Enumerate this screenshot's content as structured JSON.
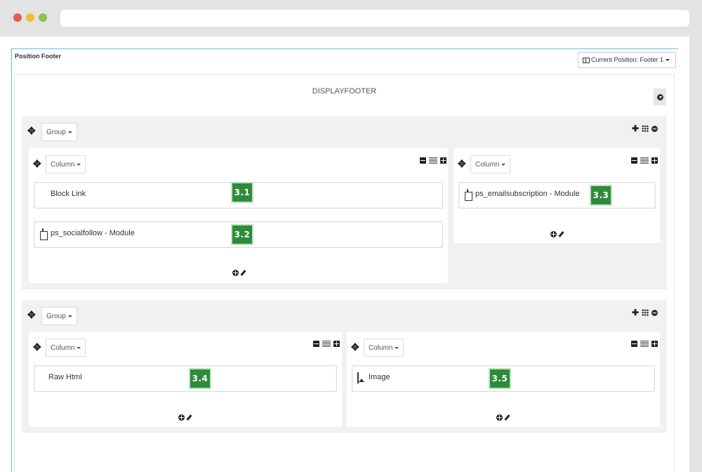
{
  "panel": {
    "title": "Position Footer",
    "position_button": "Current Position: Footer 1"
  },
  "hook": {
    "title": "DISPLAYFOOTER"
  },
  "groups": [
    {
      "dropdown": "Group",
      "columns": [
        {
          "dropdown": "Column",
          "modules": [
            {
              "label": "Block Link",
              "icon": "list-icon",
              "badge": "3.1"
            },
            {
              "label": "ps_socialfollow - Module",
              "icon": "module-icon",
              "badge": "3.2"
            }
          ]
        },
        {
          "dropdown": "Column",
          "modules": [
            {
              "label": "ps_emailsubscription - Module",
              "icon": "module-icon",
              "badge": "3.3"
            }
          ]
        }
      ]
    },
    {
      "dropdown": "Group",
      "columns": [
        {
          "dropdown": "Column",
          "modules": [
            {
              "label": "Raw Html",
              "icon": "html5-icon",
              "badge": "3.4"
            }
          ]
        },
        {
          "dropdown": "Column",
          "modules": [
            {
              "label": "Image",
              "icon": "image-icon",
              "badge": "3.5"
            }
          ]
        }
      ]
    }
  ],
  "add_group_label": "+",
  "colors": {
    "badge": "#2e8b3a",
    "accent": "#25a0d8"
  }
}
